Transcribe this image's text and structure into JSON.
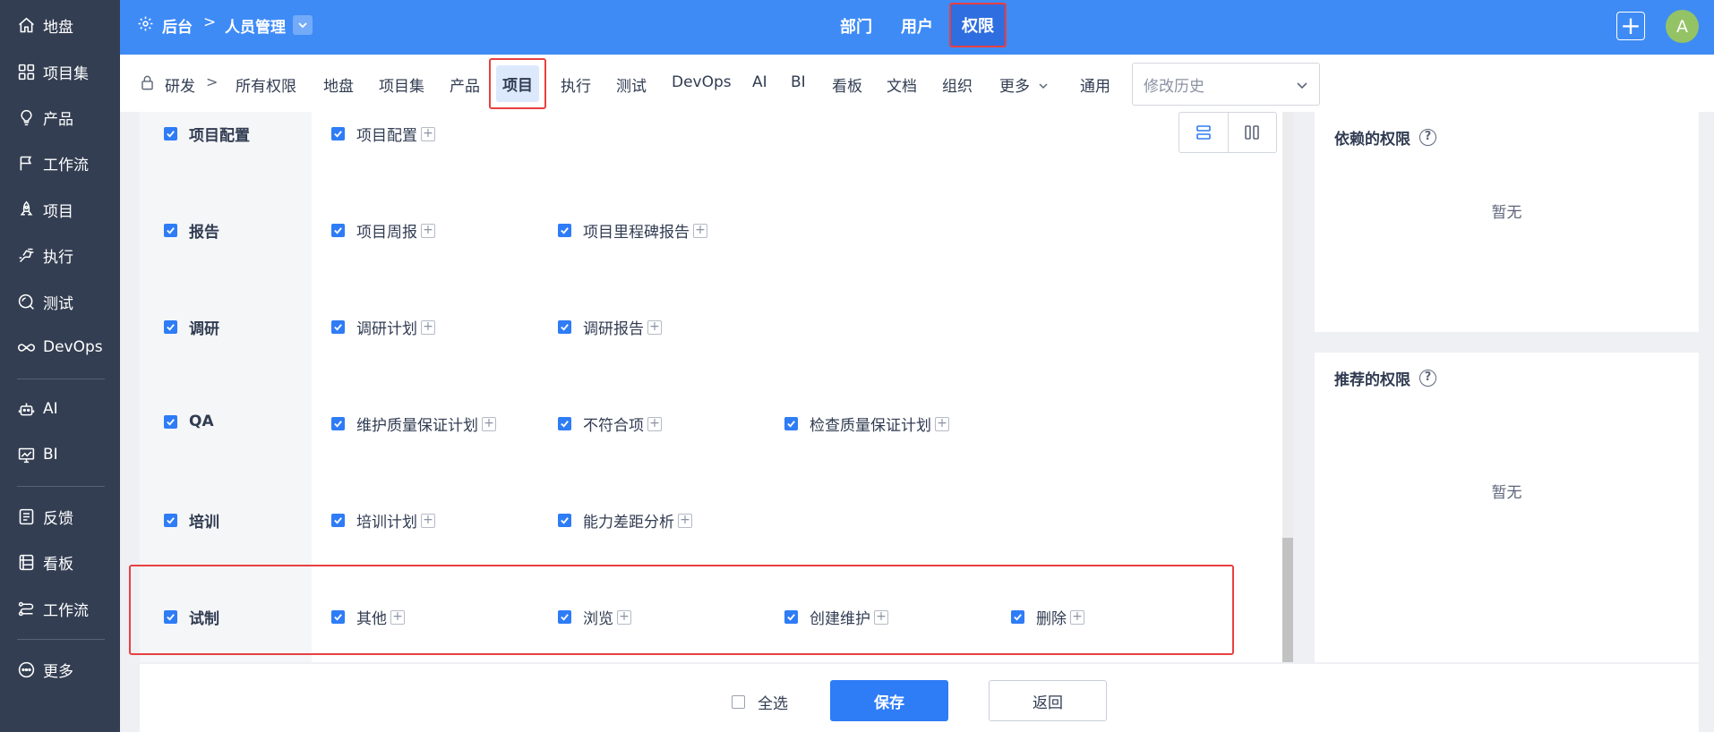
{
  "sidebar": {
    "items": [
      {
        "label": "地盘",
        "icon": "home-icon"
      },
      {
        "label": "项目集",
        "icon": "grid-icon"
      },
      {
        "label": "产品",
        "icon": "bulb-icon"
      },
      {
        "label": "工作流",
        "icon": "flag-icon"
      },
      {
        "label": "项目",
        "icon": "rocket-icon"
      },
      {
        "label": "执行",
        "icon": "run-icon"
      },
      {
        "label": "测试",
        "icon": "test-icon"
      },
      {
        "label": "DevOps",
        "icon": "infinity-icon"
      },
      {
        "label": "AI",
        "icon": "robot-icon"
      },
      {
        "label": "BI",
        "icon": "chart-icon"
      },
      {
        "label": "反馈",
        "icon": "feedback-icon"
      },
      {
        "label": "看板",
        "icon": "kanban-icon"
      },
      {
        "label": "工作流",
        "icon": "workflow-icon"
      },
      {
        "label": "更多",
        "icon": "more-icon"
      }
    ]
  },
  "header": {
    "breadcrumb_root": "后台",
    "breadcrumb_sep": ">",
    "breadcrumb_current": "人员管理",
    "tabs": [
      "部门",
      "用户",
      "权限"
    ],
    "active_tab": "权限",
    "avatar_initial": "A",
    "plus": "+"
  },
  "subnav": {
    "root": "研发",
    "chevron": ">",
    "items": [
      "所有权限",
      "地盘",
      "项目集",
      "产品",
      "项目",
      "执行",
      "测试",
      "DevOps",
      "AI",
      "BI",
      "看板",
      "文档",
      "组织",
      "更多",
      "通用"
    ],
    "active": "项目",
    "history_placeholder": "修改历史"
  },
  "permissions": {
    "rows": [
      {
        "label": "项目配置",
        "items": [
          "项目配置"
        ]
      },
      {
        "label": "报告",
        "items": [
          "项目周报",
          "项目里程碑报告"
        ]
      },
      {
        "label": "调研",
        "items": [
          "调研计划",
          "调研报告"
        ]
      },
      {
        "label": "QA",
        "items": [
          "维护质量保证计划",
          "不符合项",
          "检查质量保证计划"
        ]
      },
      {
        "label": "培训",
        "items": [
          "培训计划",
          "能力差距分析"
        ]
      },
      {
        "label": "试制",
        "items": [
          "其他",
          "浏览",
          "创建维护",
          "删除"
        ]
      }
    ],
    "expand_glyph": "+"
  },
  "dependent_card": {
    "title": "依赖的权限",
    "empty": "暂无",
    "help": "?"
  },
  "recommended_card": {
    "title": "推荐的权限",
    "empty": "暂无",
    "help": "?"
  },
  "footer": {
    "select_all": "全选",
    "save": "保存",
    "back": "返回"
  },
  "colors": {
    "primary": "#2e7cf6",
    "header": "#3e8bf6",
    "sidebar": "#333e52",
    "highlight": "#e84040"
  }
}
